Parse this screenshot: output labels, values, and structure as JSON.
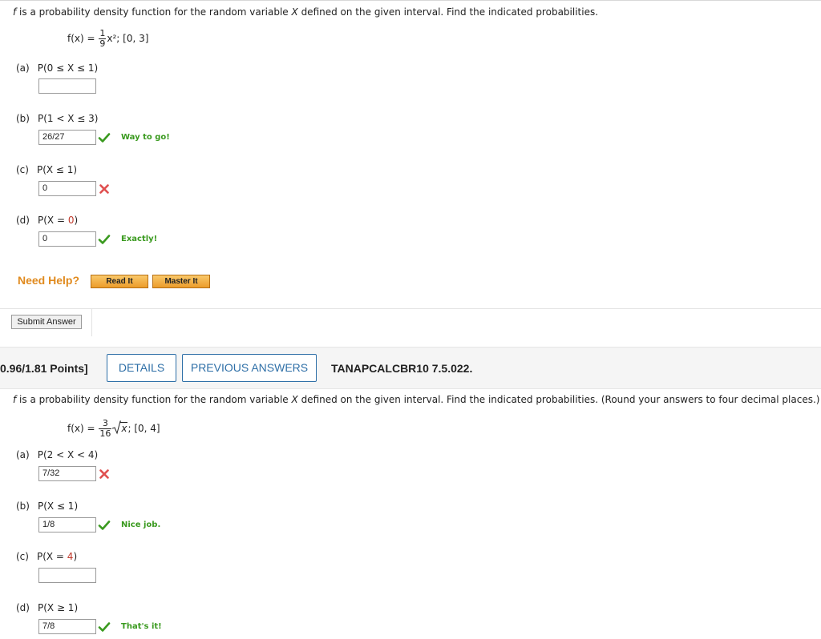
{
  "q1": {
    "prompt_var": "f",
    "prompt_pre": " is a probability density function for the random variable ",
    "prompt_X": "X",
    "prompt_post": " defined on the given interval. Find the indicated probabilities.",
    "formula_lhs": "f(x) = ",
    "formula_num": "1",
    "formula_den": "9",
    "formula_rest": "x²;  [0, 3]",
    "parts": {
      "a": {
        "letter": "(a)",
        "expr": "P(0 ≤ X ≤ 1)",
        "value": ""
      },
      "b": {
        "letter": "(b)",
        "expr": "P(1 < X ≤ 3)",
        "value": "26/27",
        "feedback": "Way to go!"
      },
      "c": {
        "letter": "(c)",
        "expr": "P(X ≤ 1)",
        "value": "0"
      },
      "d": {
        "letter": "(d)",
        "expr_pre": "P(X = ",
        "expr_red": "0",
        "expr_post": ")",
        "value": "0",
        "feedback": "Exactly!"
      }
    },
    "need_help": "Need Help?",
    "read_it": "Read It",
    "master_it": "Master It",
    "submit": "Submit Answer"
  },
  "q2": {
    "points": "0.96/1.81 Points]",
    "details": "DETAILS",
    "previous_answers": "PREVIOUS ANSWERS",
    "code": "TANAPCALCBR10 7.5.022.",
    "prompt_var": "f",
    "prompt_pre": " is a probability density function for the random variable ",
    "prompt_X": "X",
    "prompt_post": " defined on the given interval. Find the indicated probabilities. (Round your answers to four decimal places.)",
    "formula_lhs": "f(x) = ",
    "formula_num": "3",
    "formula_den": "16",
    "formula_rad": "x",
    "formula_rest": ";  [0, 4]",
    "parts": {
      "a": {
        "letter": "(a)",
        "expr": "P(2 < X < 4)",
        "value": "7/32"
      },
      "b": {
        "letter": "(b)",
        "expr": "P(X ≤ 1)",
        "value": "1/8",
        "feedback": "Nice job."
      },
      "c": {
        "letter": "(c)",
        "expr_pre": "P(X = ",
        "expr_red": "4",
        "expr_post": ")",
        "value": ""
      },
      "d": {
        "letter": "(d)",
        "expr": "P(X ≥ 1)",
        "value": "7/8",
        "feedback": "That's it!"
      }
    }
  },
  "icons": {
    "correct": "check-icon",
    "incorrect": "x-icon"
  },
  "colors": {
    "correct": "#3a9a1f",
    "incorrect": "#e05050",
    "accent_blue": "#2e6fa7",
    "help_orange": "#e08a1e"
  }
}
